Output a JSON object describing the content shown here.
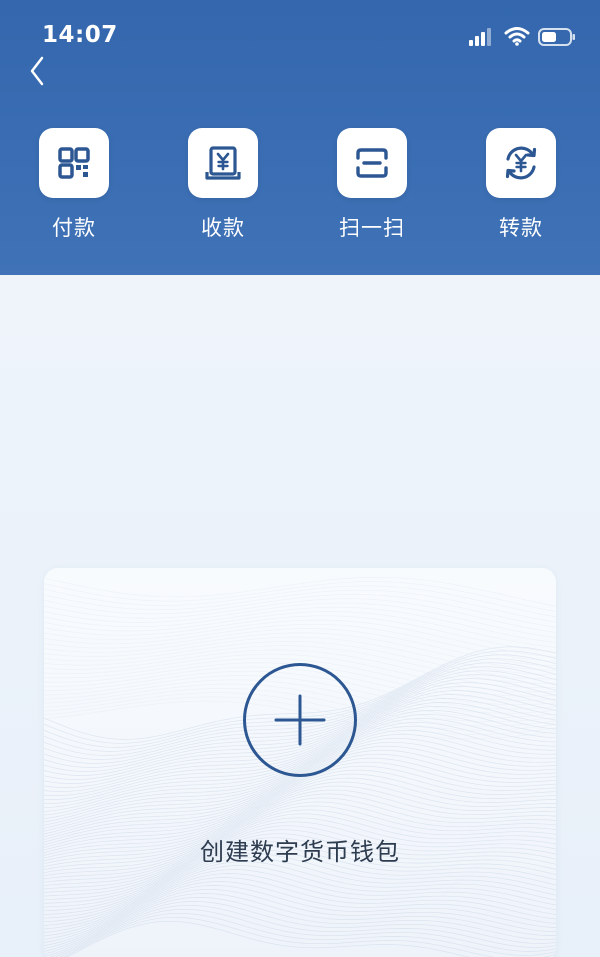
{
  "status_bar": {
    "time": "14:07"
  },
  "header": {
    "back_icon": "chevron-left-icon",
    "actions": [
      {
        "label": "付款",
        "icon": "qr-code-icon"
      },
      {
        "label": "收款",
        "icon": "yuan-receipt-icon"
      },
      {
        "label": "扫一扫",
        "icon": "scan-frame-icon"
      },
      {
        "label": "转款",
        "icon": "yuan-exchange-icon"
      }
    ]
  },
  "wallet_card": {
    "add_icon": "plus-icon",
    "create_label": "创建数字货币钱包"
  },
  "colors": {
    "header_blue": "#3467ad",
    "icon_blue": "#2c5792",
    "background": "#eef4fb",
    "text_dark": "#2e3c50"
  }
}
